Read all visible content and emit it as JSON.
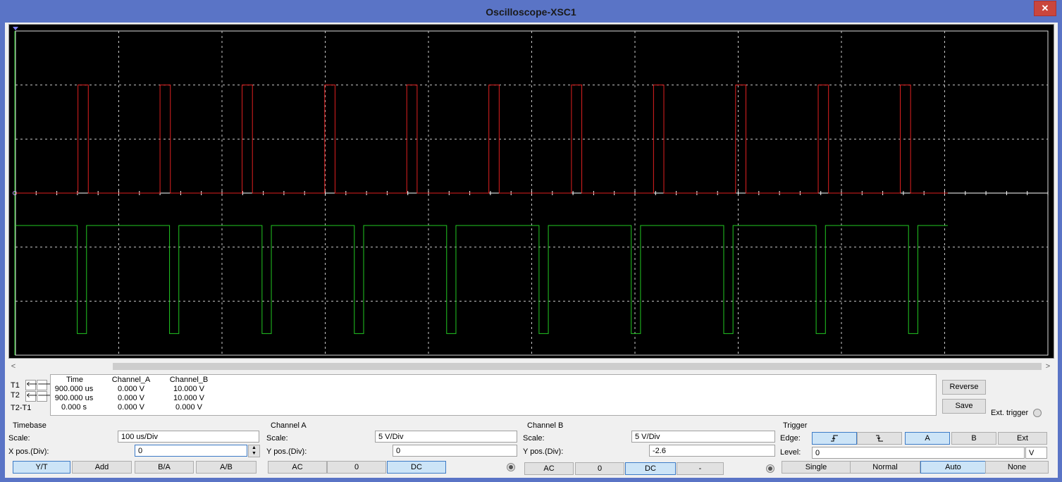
{
  "window": {
    "title": "Oscilloscope-XSC1",
    "close_label": "✕"
  },
  "colors": {
    "screen_bg": "#000000",
    "grid": "#c8c8c8",
    "channel_a": "#e02020",
    "channel_b": "#22c822",
    "selected": "#cce4f7"
  },
  "scrollbar": {
    "left_icon": "<",
    "right_icon": ">"
  },
  "cursors": {
    "t1_label": "T1",
    "t2_label": "T2",
    "diff_label": "T2-T1",
    "left_icon": "🡐",
    "right_icon": "🡒"
  },
  "readout": {
    "headers": [
      "Time",
      "Channel_A",
      "Channel_B"
    ],
    "rows": [
      [
        "900.000 us",
        "0.000 V",
        "10.000 V"
      ],
      [
        "900.000 us",
        "0.000 V",
        "10.000 V"
      ],
      [
        "0.000 s",
        "0.000 V",
        "0.000 V"
      ]
    ]
  },
  "side_buttons": {
    "reverse": "Reverse",
    "save": "Save",
    "ext_trigger": "Ext. trigger"
  },
  "timebase": {
    "title": "Timebase",
    "scale_label": "Scale:",
    "scale_value": "100 us/Div",
    "xpos_label": "X pos.(Div):",
    "xpos_value": "0",
    "modes": [
      "Y/T",
      "Add",
      "B/A",
      "A/B"
    ],
    "selected_mode": "Y/T"
  },
  "channel_a": {
    "title": "Channel A",
    "scale_label": "Scale:",
    "scale_value": "5  V/Div",
    "ypos_label": "Y pos.(Div):",
    "ypos_value": "0",
    "coupling": [
      "AC",
      "0",
      "DC"
    ],
    "selected": "DC"
  },
  "channel_b": {
    "title": "Channel B",
    "scale_label": "Scale:",
    "scale_value": "5  V/Div",
    "ypos_label": "Y pos.(Div):",
    "ypos_value": "-2.6",
    "coupling": [
      "AC",
      "0",
      "DC",
      "-"
    ],
    "selected": "DC"
  },
  "trigger": {
    "title": "Trigger",
    "edge_label": "Edge:",
    "rising_icon": "rising-edge-icon",
    "falling_icon": "falling-edge-icon",
    "sources": [
      "A",
      "B",
      "Ext"
    ],
    "selected_source": "A",
    "level_label": "Level:",
    "level_value": "0",
    "level_unit": "V",
    "modes": [
      "Single",
      "Normal",
      "Auto",
      "None"
    ],
    "selected_mode": "Auto"
  },
  "chart_data": {
    "type": "line",
    "xlabel": "",
    "ylabel": "",
    "x_divisions": 10,
    "y_divisions": 6,
    "time_per_div_us": 100,
    "series": [
      {
        "name": "Channel_A",
        "pulses_start_us": [
          60.5,
          140.0,
          219.5,
          299.5,
          379.0,
          458.5,
          538.5,
          618.0,
          697.5,
          777.5,
          857.0
        ],
        "pulse_width_us": 10.0,
        "low_v": 0,
        "high_v": 10,
        "end_us": 903
      },
      {
        "name": "Channel_B",
        "dips_start_us": [
          59.8,
          149.2,
          238.8,
          328.2,
          417.6,
          507.1,
          596.4,
          686.0,
          775.5,
          865.0
        ],
        "dip_width_us": 9.0,
        "high_v": 0,
        "low_v": -10,
        "end_us": 903
      }
    ]
  }
}
